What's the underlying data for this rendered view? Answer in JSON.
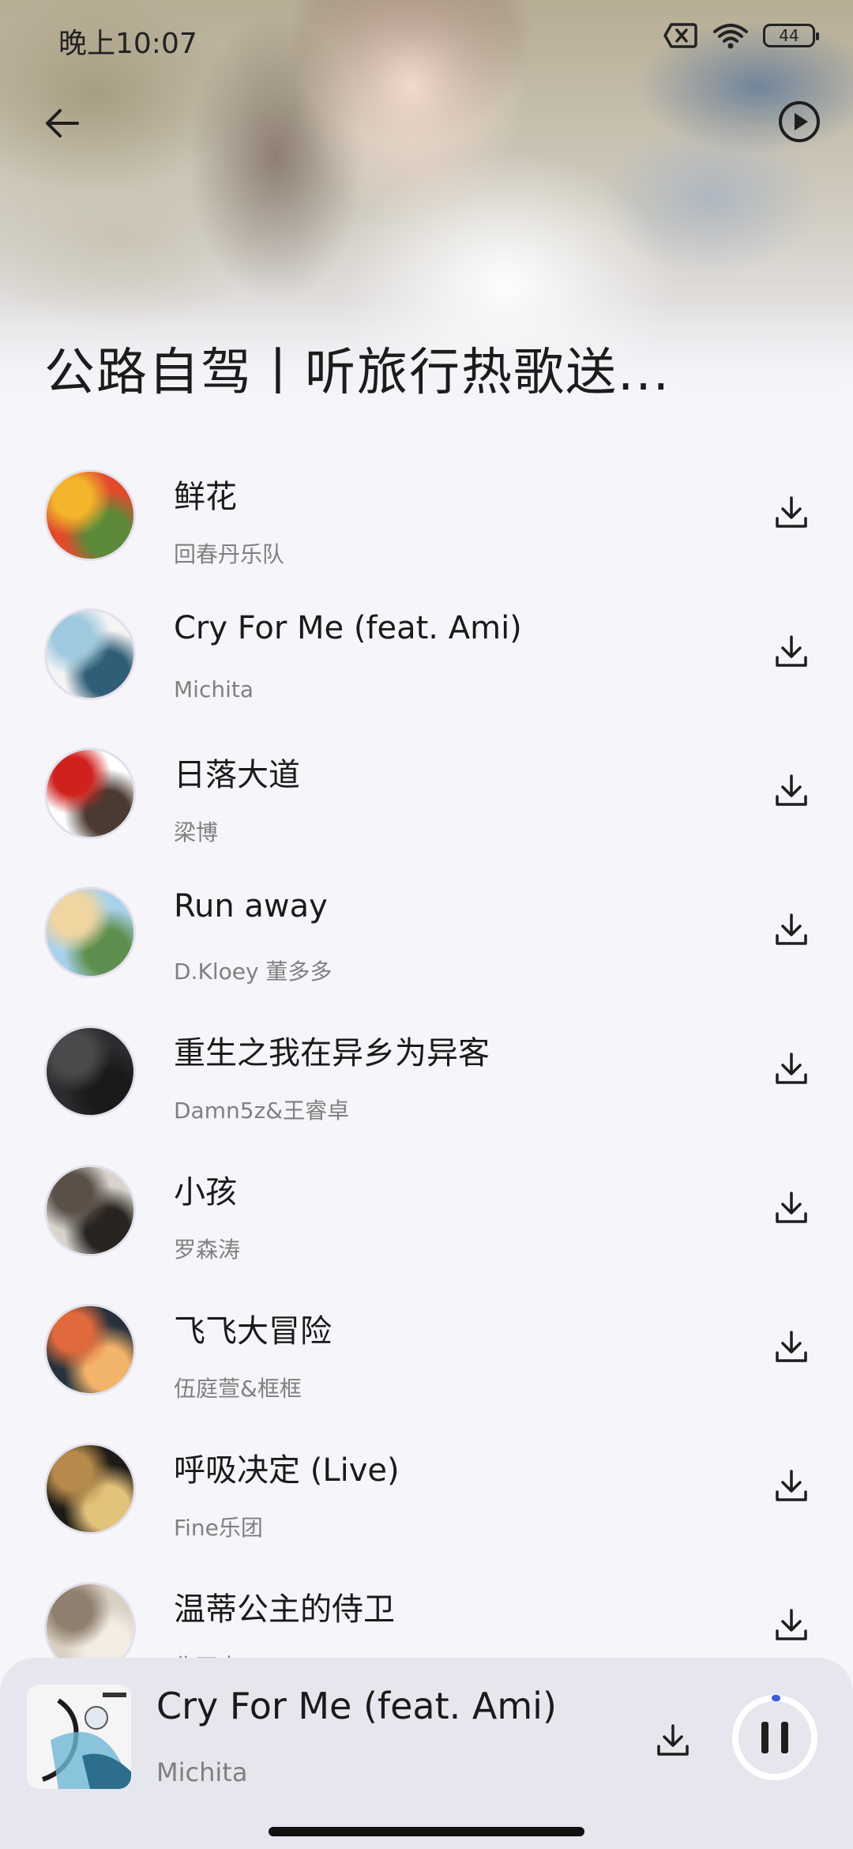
{
  "status_bar": {
    "time": "晚上10:07",
    "battery_level": "44",
    "icons": [
      "sim-off-icon",
      "wifi-icon",
      "battery-icon"
    ]
  },
  "header": {
    "title": "公路自驾丨听旅行热歌送...",
    "back_icon": "back-arrow-icon",
    "play_icon": "play-circle-icon"
  },
  "songs": [
    {
      "title": "鲜花",
      "artist": "回春丹乐队",
      "cover_colors": [
        "#e24a2c",
        "#f2b52b",
        "#5c8a3a"
      ]
    },
    {
      "title": "Cry For Me (feat. Ami)",
      "artist": "Michita",
      "cover_colors": [
        "#f4f4f4",
        "#9fc9de",
        "#2f5e76"
      ]
    },
    {
      "title": "日落大道",
      "artist": "梁博",
      "cover_colors": [
        "#ffffff",
        "#d1211c",
        "#4a3a32"
      ]
    },
    {
      "title": "Run away",
      "artist": "D.Kloey 董多多",
      "cover_colors": [
        "#a8d2ec",
        "#f1d5a0",
        "#5f8f4e"
      ]
    },
    {
      "title": "重生之我在异乡为异客",
      "artist": "Damn5z&王睿卓",
      "cover_colors": [
        "#2c2c2e",
        "#4a4a4c",
        "#1a1a1a"
      ]
    },
    {
      "title": "小孩",
      "artist": "罗森涛",
      "cover_colors": [
        "#d8d4cc",
        "#5a5048",
        "#2a2420"
      ]
    },
    {
      "title": "飞飞大冒险",
      "artist": "伍庭萱&框框",
      "cover_colors": [
        "#27313d",
        "#e06a3c",
        "#f2b46a"
      ]
    },
    {
      "title": "呼吸决定 (Live)",
      "artist": "Fine乐团",
      "cover_colors": [
        "#1e1a16",
        "#b58a4a",
        "#e3c27a"
      ]
    },
    {
      "title": "温蒂公主的侍卫",
      "artist": "焦石未",
      "cover_colors": [
        "#d9cfc2",
        "#8f7f6e",
        "#f3ede3"
      ]
    }
  ],
  "download_icon": "download-icon",
  "now_playing": {
    "title": "Cry For Me (feat. Ami)",
    "artist": "Michita",
    "progress": 0.01
  }
}
